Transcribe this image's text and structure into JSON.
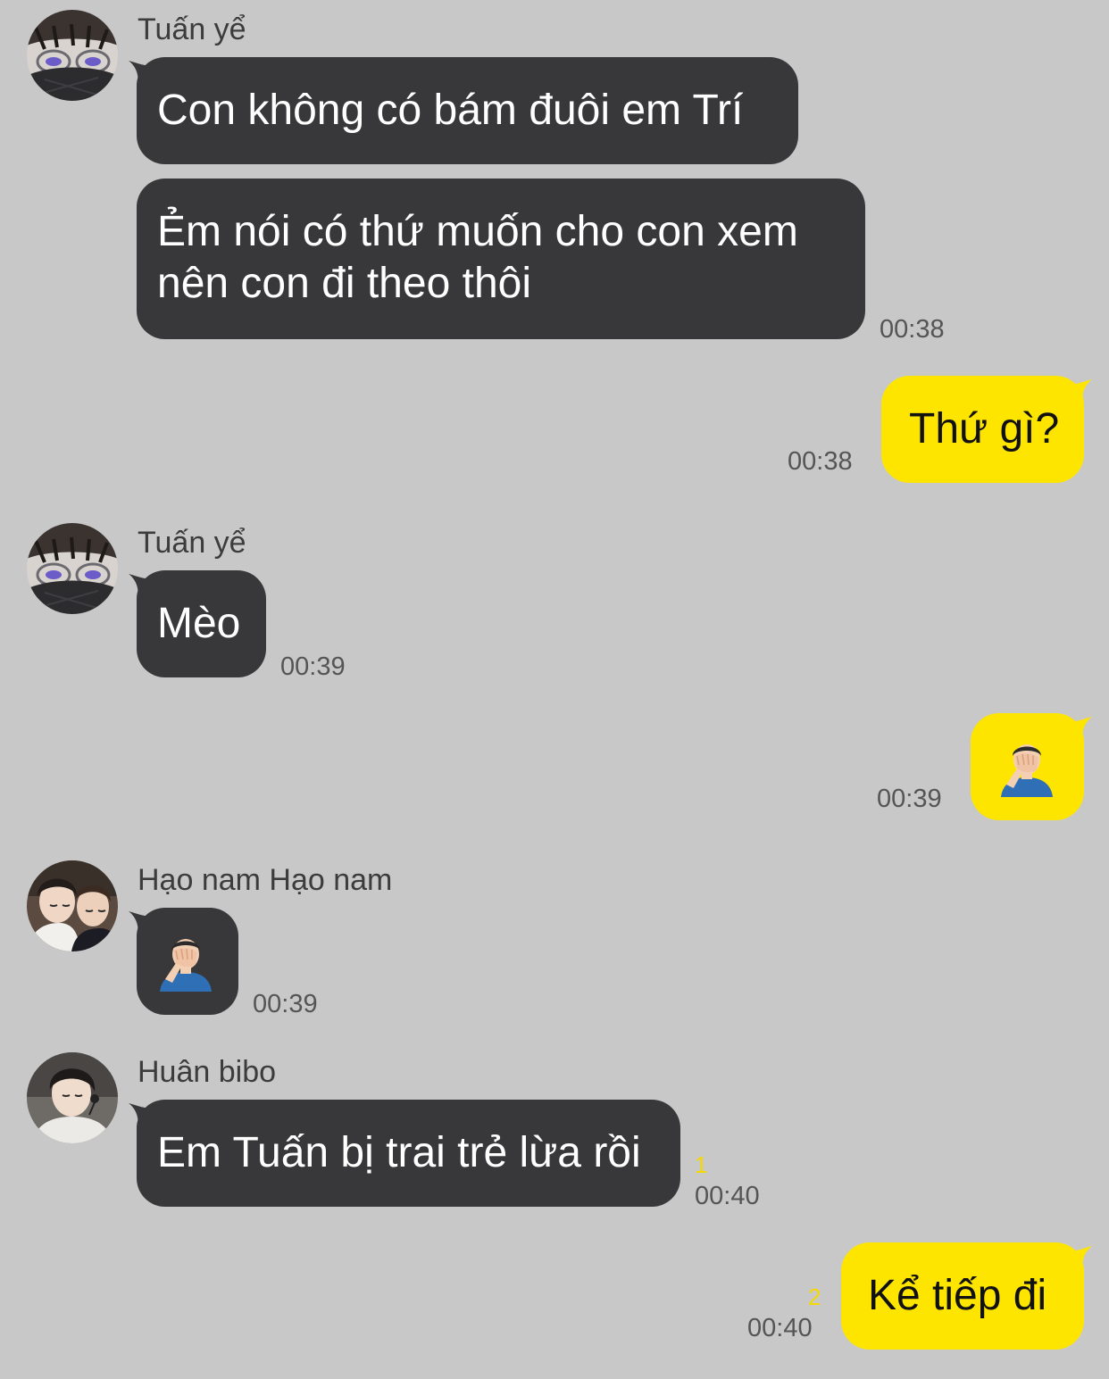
{
  "colors": {
    "background": "#c8c8c8",
    "incoming_bubble": "#38383a",
    "outgoing_bubble": "#fee500",
    "unread_count": "#f5d800"
  },
  "messages": [
    {
      "sender": "Tuấn yể",
      "avatar": "masked-glasses-avatar",
      "lines": [
        "Con không có bám đuôi em Trí"
      ]
    },
    {
      "lines": [
        "Ẻm nói có thứ muốn cho con xem",
        "nên con đi theo thôi"
      ],
      "time": "00:38"
    },
    {
      "outgoing": true,
      "lines": [
        "Thứ gì?"
      ],
      "time": "00:38"
    },
    {
      "sender": "Tuấn yể",
      "avatar": "masked-glasses-avatar",
      "lines": [
        "Mèo"
      ],
      "time": "00:39"
    },
    {
      "outgoing": true,
      "emoji": "man-facepalming-emoji",
      "time": "00:39"
    },
    {
      "sender": "Hạo nam Hạo nam",
      "avatar": "two-friends-avatar",
      "emoji": "man-facepalming-emoji",
      "time": "00:39"
    },
    {
      "sender": "Huân bibo",
      "avatar": "headset-user-avatar",
      "lines": [
        "Em Tuấn bị trai trẻ lừa rồi"
      ],
      "unread": "1",
      "time": "00:40"
    },
    {
      "outgoing": true,
      "lines": [
        "Kể tiếp đi"
      ],
      "unread": "2",
      "time": "00:40"
    }
  ]
}
